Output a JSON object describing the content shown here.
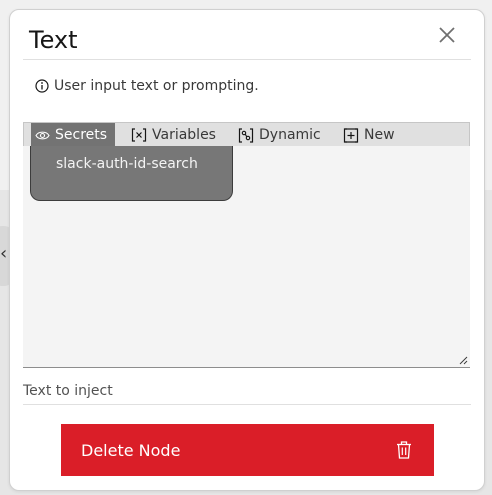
{
  "modal": {
    "title": "Text",
    "info_text": "User input text or prompting."
  },
  "editor": {
    "tabs": [
      {
        "label": "Secrets",
        "icon": "eye-icon",
        "active": true
      },
      {
        "label": "Variables",
        "icon": "variable-icon",
        "active": false
      },
      {
        "label": "Dynamic",
        "icon": "dynamic-icon",
        "active": false
      },
      {
        "label": "New",
        "icon": "add-box-icon",
        "active": false
      }
    ],
    "dropdown_items": [
      "slack-auth-id-search"
    ],
    "helper_text": "Text to inject"
  },
  "actions": {
    "delete_label": "Delete Node"
  },
  "colors": {
    "danger": "#da1e28",
    "active_tab": "#737373",
    "dropdown": "#777777"
  }
}
